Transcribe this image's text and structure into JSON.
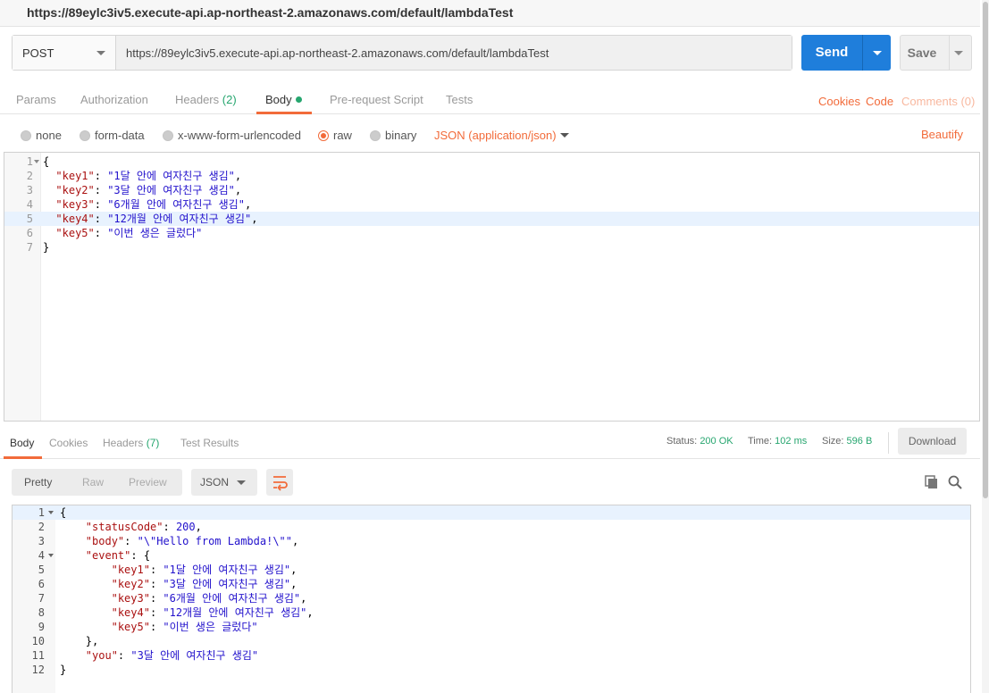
{
  "window": {
    "title": "https://89eylc3iv5.execute-api.ap-northeast-2.amazonaws.com/default/lambdaTest"
  },
  "request": {
    "method": "POST",
    "url": "https://89eylc3iv5.execute-api.ap-northeast-2.amazonaws.com/default/lambdaTest",
    "send_label": "Send",
    "save_label": "Save"
  },
  "tabs": {
    "params": "Params",
    "authorization": "Authorization",
    "headers": "Headers",
    "headers_count": "(2)",
    "body": "Body",
    "prerequest": "Pre-request Script",
    "tests": "Tests",
    "cookies": "Cookies",
    "code": "Code",
    "comments": "Comments (0)"
  },
  "body_options": {
    "none": "none",
    "form_data": "form-data",
    "urlencoded": "x-www-form-urlencoded",
    "raw": "raw",
    "binary": "binary",
    "content_type": "JSON (application/json)",
    "beautify": "Beautify"
  },
  "request_body": {
    "lines": [
      {
        "n": "1",
        "text": "{"
      },
      {
        "n": "2",
        "key": "\"key1\"",
        "sep": ": ",
        "val": "\"1달 안에 여자친구 생김\"",
        "end": ","
      },
      {
        "n": "3",
        "key": "\"key2\"",
        "sep": ": ",
        "val": "\"3달 안에 여자친구 생김\"",
        "end": ","
      },
      {
        "n": "4",
        "key": "\"key3\"",
        "sep": ": ",
        "val": "\"6개월 안에 여자친구 생김\"",
        "end": ","
      },
      {
        "n": "5",
        "key": "\"key4\"",
        "sep": ": ",
        "val": "\"12개월 안에 여자친구 생김\"",
        "end": ","
      },
      {
        "n": "6",
        "key": "\"key5\"",
        "sep": ": ",
        "val": "\"이번 생은 글렀다\"",
        "end": ""
      },
      {
        "n": "7",
        "text": "}"
      }
    ]
  },
  "response_tabs": {
    "body": "Body",
    "cookies": "Cookies",
    "headers": "Headers",
    "headers_count": "(7)",
    "test_results": "Test Results"
  },
  "response_meta": {
    "status_label": "Status:",
    "status_value": "200 OK",
    "time_label": "Time:",
    "time_value": "102 ms",
    "size_label": "Size:",
    "size_value": "596 B",
    "download": "Download"
  },
  "view": {
    "pretty": "Pretty",
    "raw": "Raw",
    "preview": "Preview",
    "format": "JSON"
  },
  "response_body": {
    "lines": [
      {
        "n": "1",
        "text": "{"
      },
      {
        "n": "2",
        "key": "\"statusCode\"",
        "sep": ": ",
        "val": "200",
        "end": ","
      },
      {
        "n": "3",
        "key": "\"body\"",
        "sep": ": ",
        "val": "\"\\\"Hello from Lambda!\\\"\"",
        "end": ","
      },
      {
        "n": "4",
        "key": "\"event\"",
        "sep": ": ",
        "text_after": "{"
      },
      {
        "n": "5",
        "key": "\"key1\"",
        "sep": ": ",
        "val": "\"1달 안에 여자친구 생김\"",
        "end": ","
      },
      {
        "n": "6",
        "key": "\"key2\"",
        "sep": ": ",
        "val": "\"3달 안에 여자친구 생김\"",
        "end": ","
      },
      {
        "n": "7",
        "key": "\"key3\"",
        "sep": ": ",
        "val": "\"6개월 안에 여자친구 생김\"",
        "end": ","
      },
      {
        "n": "8",
        "key": "\"key4\"",
        "sep": ": ",
        "val": "\"12개월 안에 여자친구 생김\"",
        "end": ","
      },
      {
        "n": "9",
        "key": "\"key5\"",
        "sep": ": ",
        "val": "\"이번 생은 글렀다\"",
        "end": ""
      },
      {
        "n": "10",
        "text": "},"
      },
      {
        "n": "11",
        "key": "\"you\"",
        "sep": ": ",
        "val": "\"3달 안에 여자친구 생김\"",
        "end": ""
      },
      {
        "n": "12",
        "text": "}"
      }
    ]
  },
  "colors": {
    "accent": "#f26b3a",
    "primary": "#1f7edb",
    "success": "#26a66f"
  }
}
